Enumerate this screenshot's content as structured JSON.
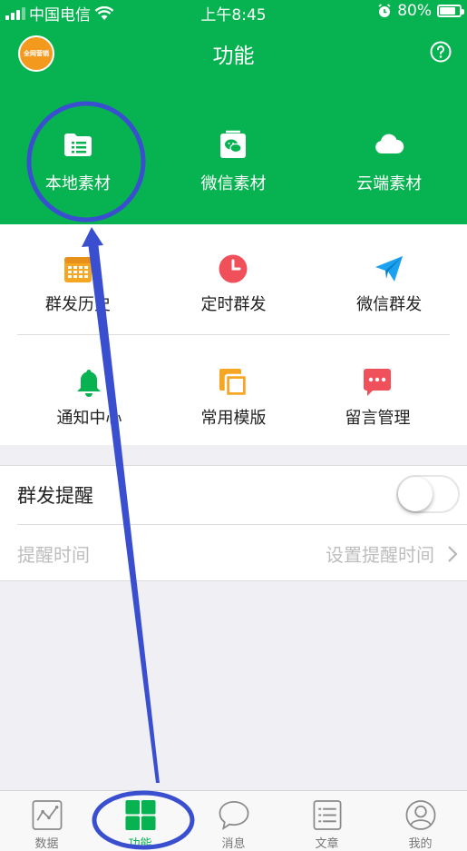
{
  "status_bar": {
    "carrier": "中国电信",
    "time": "上午8:45",
    "battery": "80%",
    "battery_level": 0.8
  },
  "header": {
    "logo_text": "全网营销",
    "title": "功能"
  },
  "green_band": {
    "items": [
      {
        "label": "本地素材",
        "icon": "folder-list-icon"
      },
      {
        "label": "微信素材",
        "icon": "wechat-folder-icon"
      },
      {
        "label": "云端素材",
        "icon": "cloud-icon"
      }
    ]
  },
  "grid": {
    "items": [
      {
        "label": "群发历史",
        "icon": "calendar-icon",
        "color": "#f5a623"
      },
      {
        "label": "定时群发",
        "icon": "clock-icon",
        "color": "#f0505a"
      },
      {
        "label": "微信群发",
        "icon": "paper-plane-icon",
        "color": "#1aa1f0"
      },
      {
        "label": "通知中心",
        "icon": "bell-icon",
        "color": "#07b350"
      },
      {
        "label": "常用模版",
        "icon": "copy-icon",
        "color": "#f5a623"
      },
      {
        "label": "留言管理",
        "icon": "message-icon",
        "color": "#f0505a"
      }
    ]
  },
  "settings": {
    "reminder": {
      "label": "群发提醒",
      "enabled": false
    },
    "reminder_time": {
      "label": "提醒时间",
      "value": "设置提醒时间"
    }
  },
  "tabbar": {
    "tabs": [
      {
        "label": "数据",
        "icon": "chart-icon"
      },
      {
        "label": "功能",
        "icon": "grid-icon",
        "active": true
      },
      {
        "label": "消息",
        "icon": "chat-bubble-icon"
      },
      {
        "label": "文章",
        "icon": "article-list-icon"
      },
      {
        "label": "我的",
        "icon": "user-icon"
      }
    ]
  },
  "colors": {
    "brand_green": "#07b350",
    "annotation_blue": "#3a4fd0"
  }
}
